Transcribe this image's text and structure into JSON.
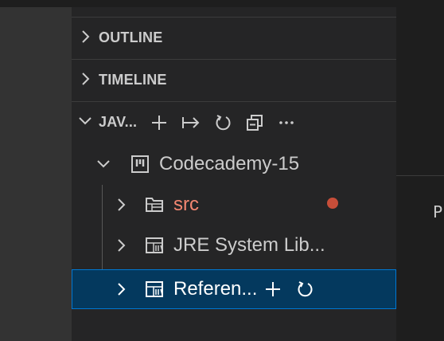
{
  "sections": {
    "outline": {
      "title": "OUTLINE",
      "icon": "chevron-right-icon"
    },
    "timeline": {
      "title": "TIMELINE",
      "icon": "chevron-right-icon"
    },
    "java_projects": {
      "title": "JAV...",
      "icon": "chevron-down-icon",
      "actions": [
        "add-icon",
        "link-to-editor-icon",
        "refresh-icon",
        "collapse-all-icon",
        "more-icon"
      ]
    }
  },
  "tree": {
    "project": {
      "label": "Codecademy-15",
      "icon": "project-icon",
      "expanded": true
    },
    "items": [
      {
        "label": "src",
        "icon": "package-folder-icon",
        "status": "error",
        "status_color": "#c74e39"
      },
      {
        "label": "JRE System Lib...",
        "icon": "library-icon"
      },
      {
        "label": "Referen...",
        "icon": "library-icon",
        "selected": true,
        "actions": [
          "add-icon",
          "refresh-icon"
        ]
      }
    ]
  },
  "editor": {
    "clipped_text": "P"
  },
  "colors": {
    "selection_bg": "#04395e",
    "selection_border": "#0078d4",
    "error_text": "#f48771"
  }
}
